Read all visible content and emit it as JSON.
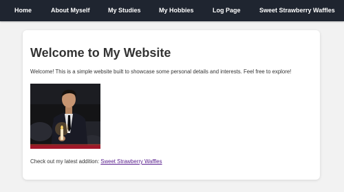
{
  "nav": {
    "items": [
      {
        "label": "Home"
      },
      {
        "label": "About Myself"
      },
      {
        "label": "My Studies"
      },
      {
        "label": "My Hobbies"
      },
      {
        "label": "Log Page"
      },
      {
        "label": "Sweet Strawberry Waffles"
      }
    ]
  },
  "main": {
    "title": "Welcome to My Website",
    "intro": "Welcome! This is a simple website built to showcase some personal details and interests. Feel free to explore!",
    "latest_prefix": "Check out my latest addition: ",
    "latest_link": "Sweet Strawberry Waffles"
  },
  "colors": {
    "nav_bg": "#1f2530",
    "page_bg": "#f2f2f2",
    "link_visited": "#551a8b"
  }
}
